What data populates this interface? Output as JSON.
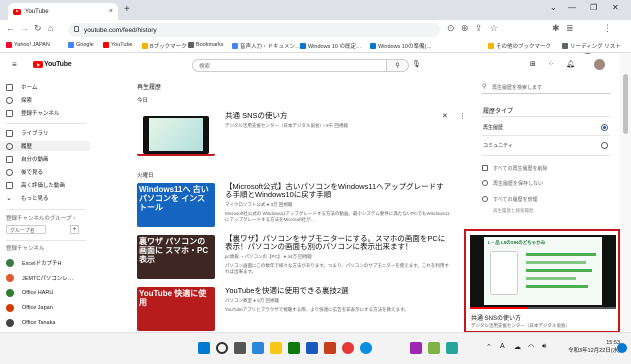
{
  "browser": {
    "tab_title": "YouTube",
    "url": "youtube.com/feed/history",
    "bookmarks": [
      {
        "label": "Yahoo! JAPAN",
        "color": "#ff0033"
      },
      {
        "label": "Google",
        "color": "#4285f4"
      },
      {
        "label": "YouTube",
        "color": "#ff0000"
      },
      {
        "label": "Bブックマーク",
        "color": "#f4b400"
      },
      {
        "label": "Bookmarks",
        "color": "#5f6368"
      },
      {
        "label": "音声入力・ドキュメン…",
        "color": "#4285f4"
      },
      {
        "label": "Windows 10 の既定…",
        "color": "#0078d4"
      },
      {
        "label": "Windows 10の準備(…",
        "color": "#0078d4"
      }
    ],
    "bookmarks_right": [
      "その他のブックマーク",
      "リーディング リスト"
    ]
  },
  "youtube": {
    "logo_text": "YouTube",
    "search_placeholder": "検索"
  },
  "sidebar": {
    "items": [
      {
        "label": "ホーム",
        "icon": "home-icon"
      },
      {
        "label": "探索",
        "icon": "explore-icon"
      },
      {
        "label": "登録チャンネル",
        "icon": "subscriptions-icon"
      },
      {
        "label": "ライブラリ",
        "icon": "library-icon"
      },
      {
        "label": "履歴",
        "icon": "history-icon"
      },
      {
        "label": "自分の動画",
        "icon": "my-videos-icon"
      },
      {
        "label": "後で見る",
        "icon": "watch-later-icon"
      },
      {
        "label": "高く評価した動画",
        "icon": "liked-icon"
      },
      {
        "label": "もっと見る",
        "icon": "chevron-down-icon"
      }
    ],
    "group_heading": "登録チャンネルのグループ・",
    "group_item": "グループ名",
    "subs_heading": "登録チャンネル",
    "channels": [
      {
        "name": "ExcelドカプチH",
        "color": "#3a7d44"
      },
      {
        "name": "JEMTCパソコンレ…",
        "color": "#e05a2b"
      },
      {
        "name": "Office HARU",
        "color": "#2e7d32"
      },
      {
        "name": "Office Japan",
        "color": "#d83b01"
      },
      {
        "name": "Office Tanaka",
        "color": "#444444"
      }
    ]
  },
  "history": {
    "page_title": "再生履歴",
    "day_today": "今日",
    "day_tuesday": "火曜日",
    "videos": [
      {
        "title": "共通 SNSの使い方",
        "channel": "デジタル活用支援センター（日本デジタル協会）・8千 回視聴",
        "desc": "",
        "thumb_text": "",
        "thumb_bg": "#1f9a54"
      },
      {
        "title": "【Microsoft公式】古いパソコンをWindows11へアップグレードする手順とWindows10に戻す手順",
        "channel": "マイクロソフト公式 ● 3万 回視聴",
        "desc": "Microsoft社公式の Windows11アップグレードする方法の動画。最小システム要件に満たないPCでもWindows11にアップグレードする方法をMicrosoft社が…",
        "thumb_text": "Windows11へ 古いパソコンを インストール",
        "thumb_bg": "#1565c0"
      },
      {
        "title": "【裏ワザ】パソコンをサブモニターにする。スマホの画面をPCに表示！パソコンの画面も別のパソコンに表示出来ます！",
        "channel": "pc情報 ・パソコンの【PC】 ● 44万 回視聴",
        "desc": "パソコン画面にこの数年で様々な方法があります。つまり、パソコンのサブモニターを使えます。これを利用すれば出来ます。",
        "thumb_text": "裏ワザ パソコンの画面に スマホ・PC 表示",
        "thumb_bg": "#3e2723"
      },
      {
        "title": "YouTubeを快適に使用できる裏技2選",
        "channel": "パソコン教室 ● 8万 回視聴",
        "desc": "YouTubeアプリとブラウザで視聴する際、より快適に広告を非表示にする方法を教えます。",
        "thumb_text": "YouTube 快適に使用",
        "thumb_bg": "#b71c1c"
      }
    ]
  },
  "right_panel": {
    "search_placeholder": "再生履歴を検索します",
    "history_type_heading": "履歴タイプ",
    "options": [
      {
        "label": "再生履歴",
        "selected": true
      },
      {
        "label": "コミュニティ",
        "selected": false
      }
    ],
    "actions": [
      "すべての再生履歴を削除",
      "再生履歴を保存しない",
      "すべての履歴を管理"
    ],
    "actions_sub": "再生履歴と検索履歴"
  },
  "miniplayer": {
    "title": "共通 SNSの使い方",
    "channel": "デジタル活用支援センター（日本デジタル協会）",
    "top_text": "L・品 L5のSINのどちゃかみ"
  },
  "taskbar": {
    "time": "15:53",
    "date": "令和3年12月22日(水)"
  }
}
